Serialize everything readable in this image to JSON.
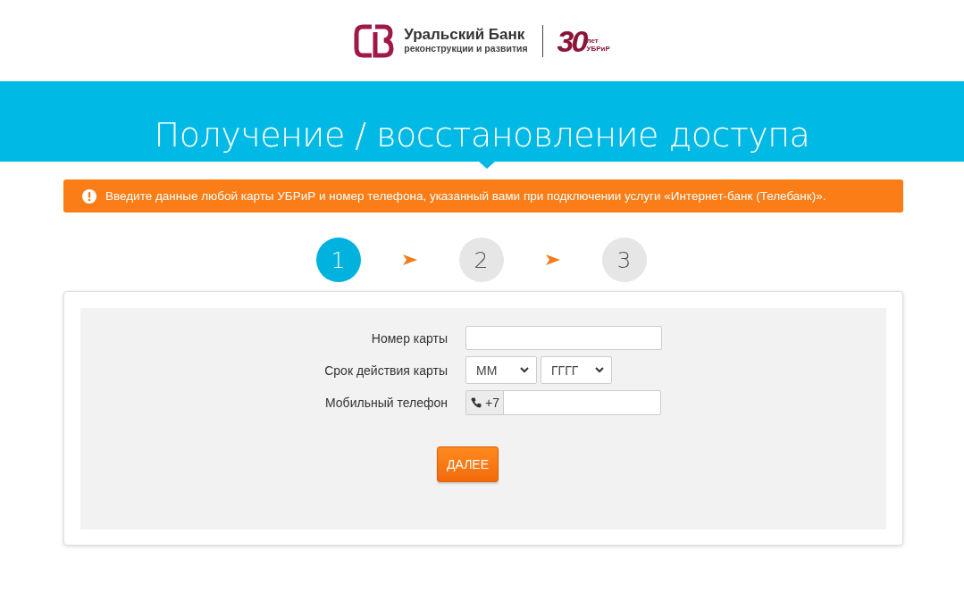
{
  "logo": {
    "name": "Уральский Банк",
    "tagline": "реконструкции и развития",
    "anniversary": "30",
    "anniversary_unit": "лет",
    "anniversary_brand": "УБРиР"
  },
  "page_title": "Получение / восстановление доступа",
  "alert": {
    "text": "Введите данные любой карты УБРиР и номер телефона, указанный вами при подключении услуги «Интернет-банк (Телебанк)»."
  },
  "steps": [
    {
      "label": "1",
      "selected": true
    },
    {
      "label": "2",
      "selected": false
    },
    {
      "label": "3",
      "selected": false
    }
  ],
  "form": {
    "fields": [
      {
        "kind": "text",
        "label": "Номер карты"
      },
      {
        "kind": "expiry",
        "label": "Срок действия карты",
        "selects": [
          "ММ",
          "ГГГГ"
        ]
      },
      {
        "kind": "phone",
        "label": "Мобильный телефон",
        "prefix": "+7"
      }
    ],
    "submit": "ДАЛЕЕ"
  }
}
